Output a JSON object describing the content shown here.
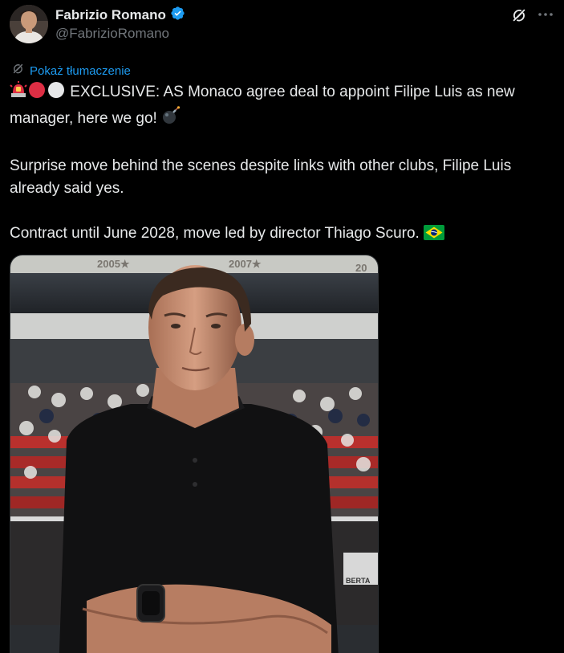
{
  "user": {
    "name": "Fabrizio Romano",
    "handle": "@FabrizioRomano"
  },
  "translate": {
    "label": "Pokaż tłumaczenie"
  },
  "tweet": {
    "line1_text": "EXCLUSIVE: AS Monaco agree deal to appoint Filipe Luis as new manager, here we go!",
    "para2": "Surprise move behind the scenes despite links with other clubs, Filipe Luis already said yes.",
    "para3_text": "Contract until June 2028, move led by director Thiago Scuro."
  },
  "media": {
    "banner_left": "2005★",
    "banner_mid": "2007★",
    "banner_right": "20",
    "board_text": "BERTA"
  },
  "colors": {
    "background": "#000000",
    "text": "#e7e9ea",
    "muted": "#71767b",
    "link": "#1d9bf0",
    "verified": "#1d9bf0"
  },
  "icons": [
    "verified-badge-icon",
    "grok-icon",
    "more-icon",
    "translate-icon",
    "siren-emoji",
    "red-circle-emoji",
    "white-circle-emoji",
    "bomb-emoji",
    "brazil-flag-emoji"
  ]
}
